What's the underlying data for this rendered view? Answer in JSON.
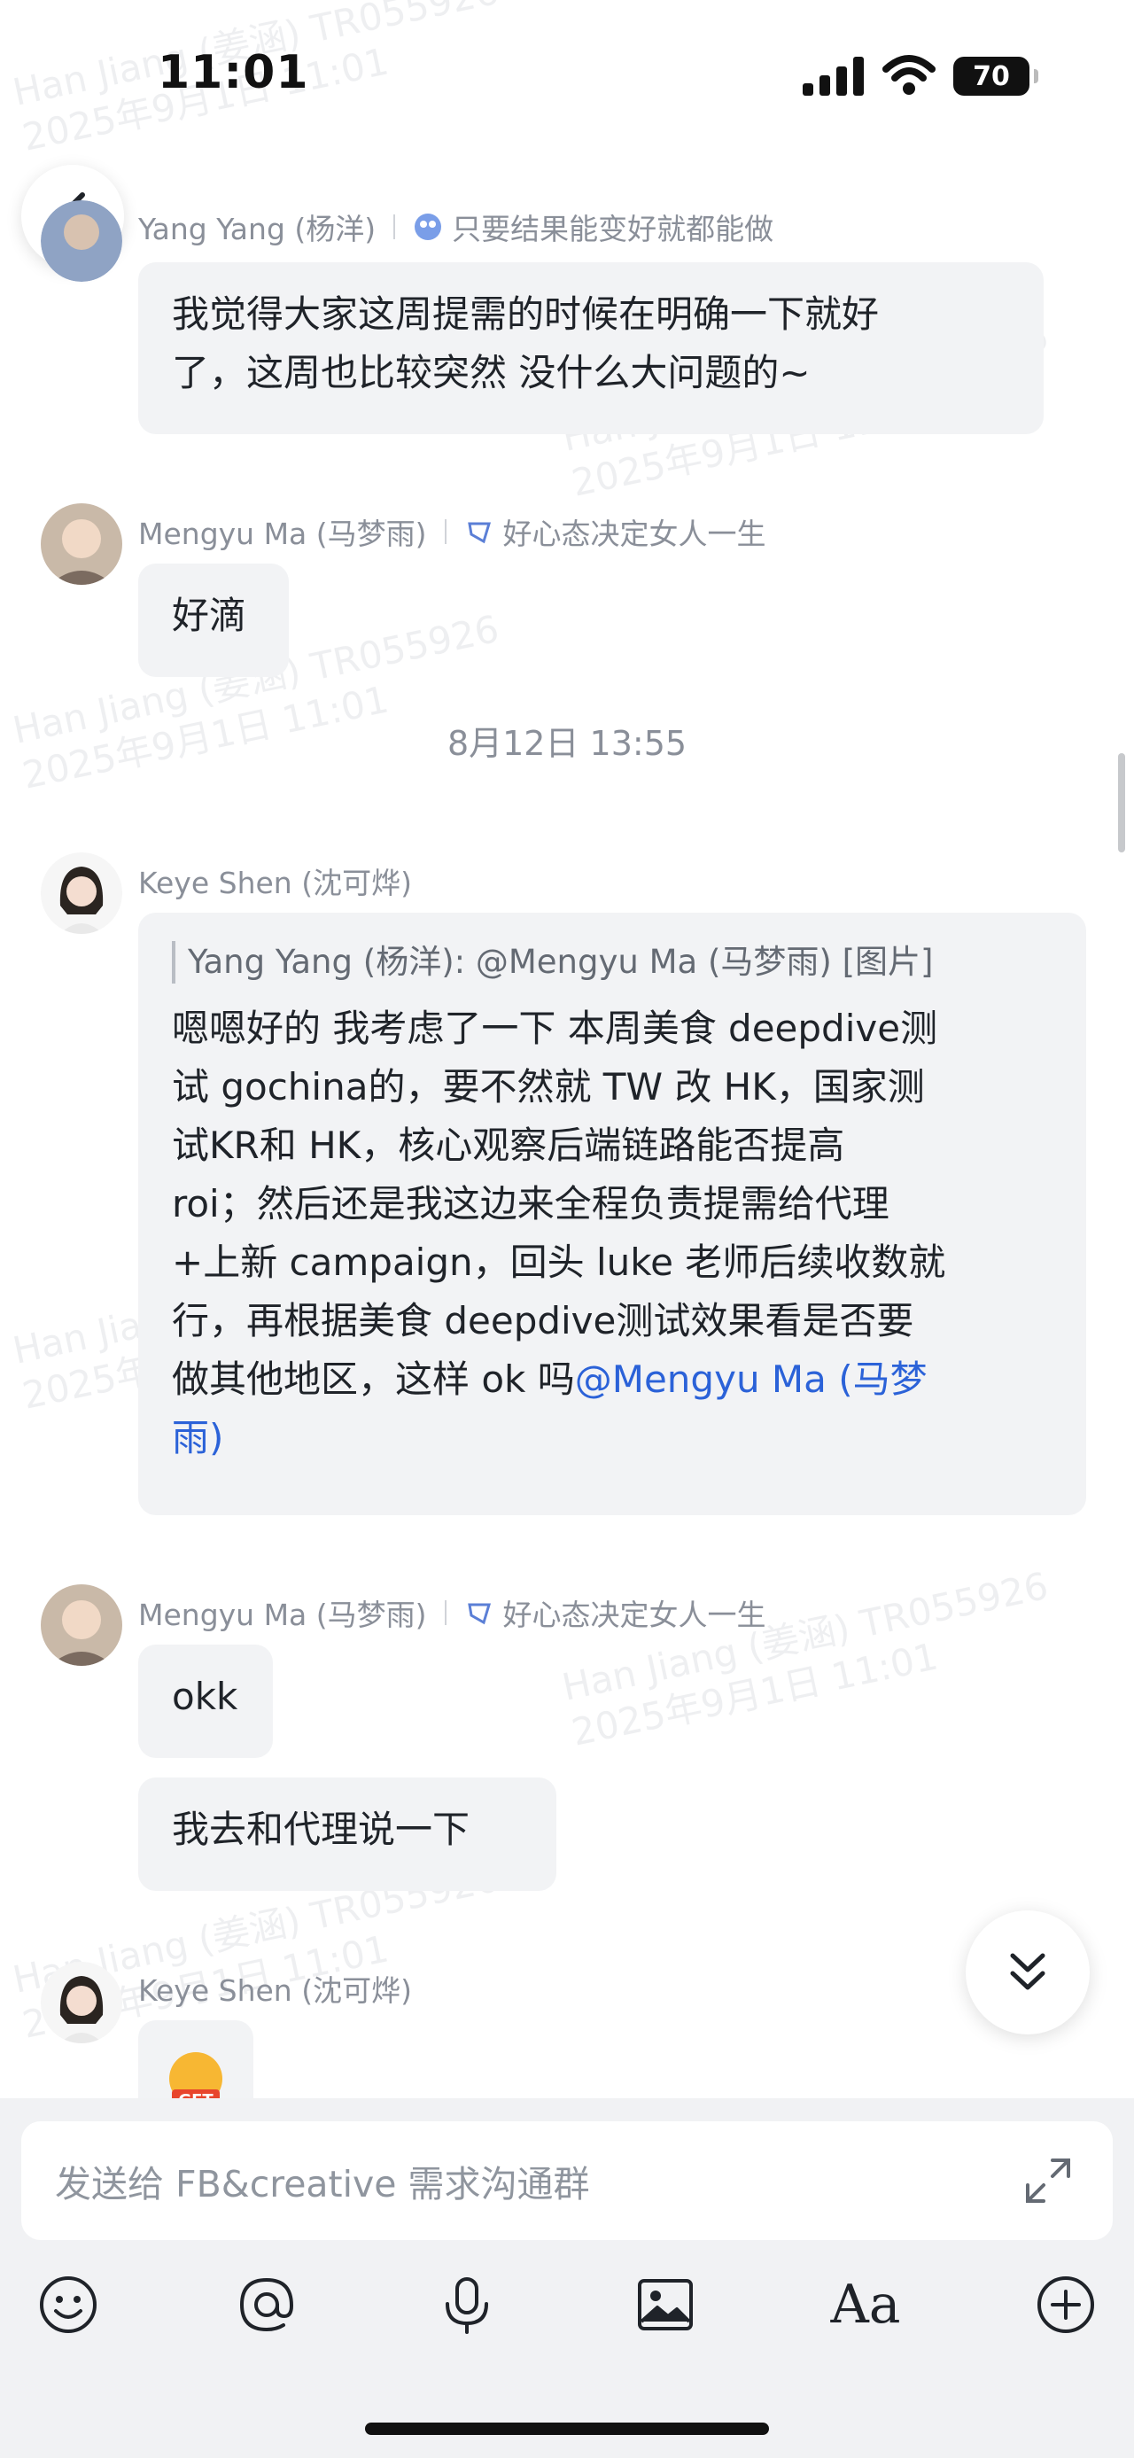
{
  "status_bar": {
    "time": "11:01",
    "battery": "70"
  },
  "watermark": {
    "line1": "Han Jiang (姜涵) TR055926",
    "line2": "2025年9月1日 11:01"
  },
  "messages": [
    {
      "sender": "Yang Yang (杨洋)",
      "signature": "只要结果能变好就都能做",
      "lines": [
        "我觉得大家这周提需的时候在明确一下就好",
        "了，这周也比较突然 没什么大问题的~"
      ]
    },
    {
      "sender": "Mengyu Ma (马梦雨)",
      "signature": "好心态决定女人一生",
      "lines": [
        "好滴"
      ]
    },
    {
      "timestamp": "8月12日 13:55"
    },
    {
      "sender": "Keye Shen (沈可烨)",
      "quote": "Yang Yang (杨洋): @Mengyu Ma (马梦雨) [图片]",
      "lines": [
        "嗯嗯好的 我考虑了一下 本周美食 deepdive测",
        "试 gochina的，要不然就 TW 改 HK，国家测",
        "试KR和 HK，核心观察后端链路能否提高",
        "roi；然后还是我这边来全程负责提需给代理",
        "+上新 campaign，回头 luke 老师后续收数就",
        "行，再根据美食 deepdive测试效果看是否要"
      ],
      "last_line_text": "做其他地区，这样 ok 吗",
      "mention_part1": "@Mengyu Ma (马梦",
      "mention_part2": "雨)"
    },
    {
      "sender": "Mengyu Ma (马梦雨)",
      "signature": "好心态决定女人一生",
      "bubbles": [
        "okk",
        "我去和代理说一下"
      ]
    },
    {
      "sender": "Keye Shen (沈可烨)",
      "sticker": "GET"
    }
  ],
  "composer": {
    "placeholder": "发送给 FB&creative 需求沟通群",
    "toolbar": [
      "emoji-icon",
      "mention-icon",
      "microphone-icon",
      "image-icon",
      "text-format-icon",
      "add-icon"
    ],
    "format_label": "Aa"
  },
  "colors": {
    "bubble": "#f2f3f5",
    "mention": "#2b62d8",
    "composer_bg": "#f1f2f4"
  }
}
